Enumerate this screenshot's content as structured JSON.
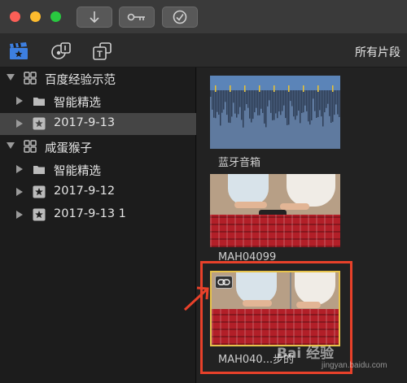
{
  "toolbar": {
    "browser_title": "所有片段"
  },
  "sidebar": {
    "libraries": [
      {
        "name": "百度经验示范",
        "events": [
          {
            "label": "智能精选",
            "type": "folder"
          },
          {
            "label": "2017-9-13",
            "type": "event",
            "selected": true
          }
        ]
      },
      {
        "name": "咸蛋猴子",
        "events": [
          {
            "label": "智能精选",
            "type": "folder"
          },
          {
            "label": "2017-9-12",
            "type": "event"
          },
          {
            "label": "2017-9-13 1",
            "type": "event"
          }
        ]
      }
    ]
  },
  "browser": {
    "clips": [
      {
        "label": "蓝牙音箱",
        "kind": "audio"
      },
      {
        "label": "MAH04099",
        "kind": "video"
      },
      {
        "label": "MAH040...步的",
        "kind": "video",
        "selected": true
      }
    ]
  },
  "watermark": {
    "brand": "Bai 经验",
    "url": "jingyan.baidu.com"
  },
  "colors": {
    "highlight": "#e8412a",
    "selection": "#e7c34b",
    "accent_blue": "#3d7fe0"
  }
}
